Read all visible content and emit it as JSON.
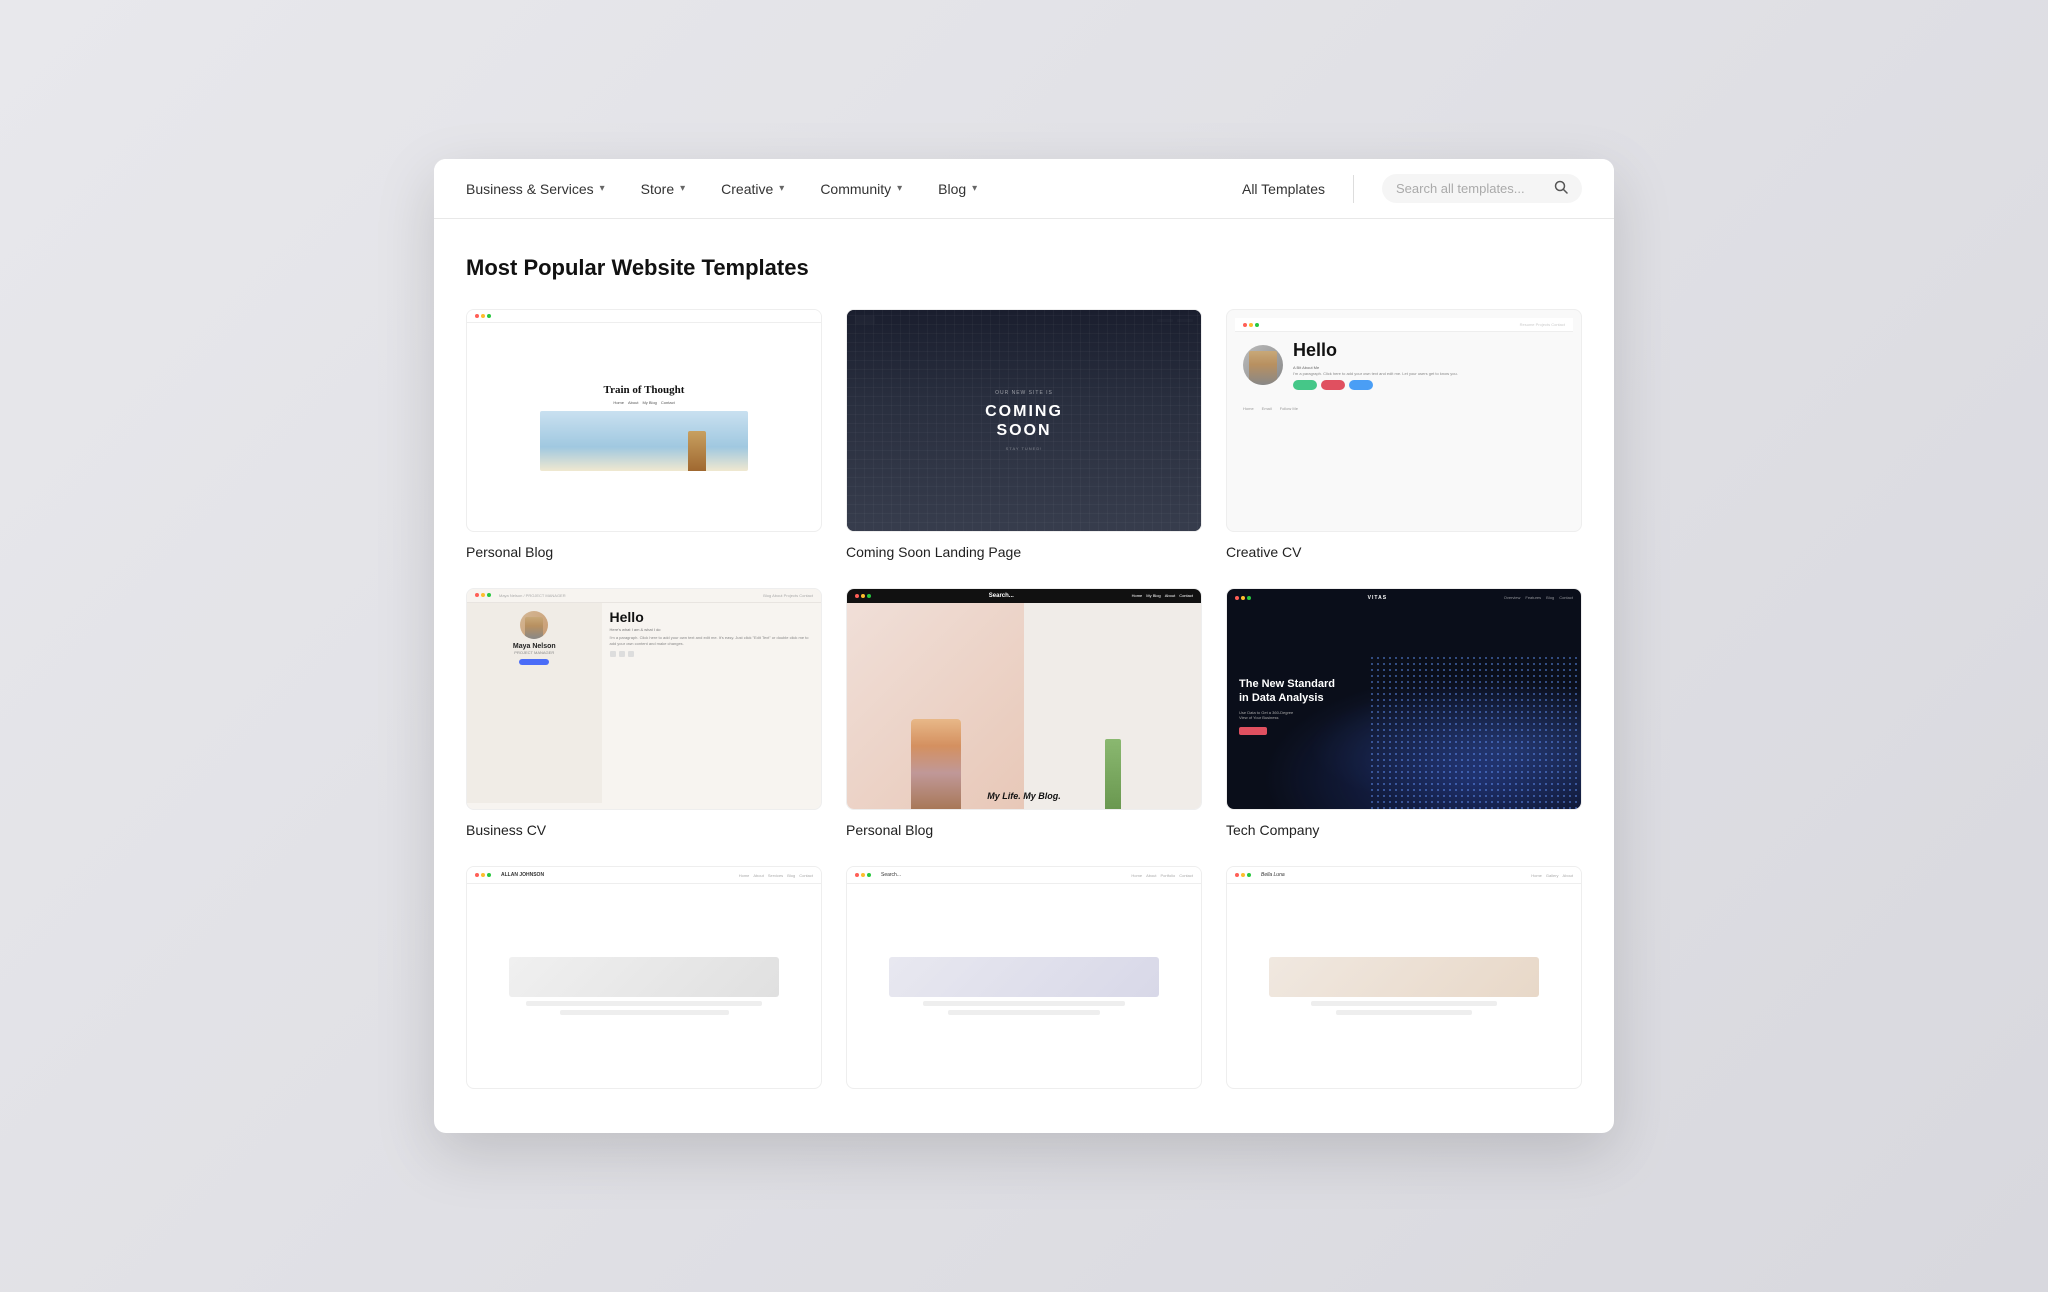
{
  "nav": {
    "items": [
      {
        "label": "Business & Services",
        "id": "business-services"
      },
      {
        "label": "Store",
        "id": "store"
      },
      {
        "label": "Creative",
        "id": "creative"
      },
      {
        "label": "Community",
        "id": "community"
      },
      {
        "label": "Blog",
        "id": "blog"
      }
    ],
    "all_templates_label": "All Templates",
    "search_placeholder": "Search all templates..."
  },
  "main": {
    "section_title": "Most Popular Website Templates",
    "templates": [
      {
        "id": "personal-blog-1",
        "name": "Personal Blog",
        "thumb_type": "personal-blog-1"
      },
      {
        "id": "coming-soon",
        "name": "Coming Soon Landing Page",
        "thumb_type": "coming-soon"
      },
      {
        "id": "creative-cv",
        "name": "Creative CV",
        "thumb_type": "creative-cv"
      },
      {
        "id": "business-cv",
        "name": "Business CV",
        "thumb_type": "business-cv"
      },
      {
        "id": "personal-blog-2",
        "name": "Personal Blog",
        "thumb_type": "personal-blog-2"
      },
      {
        "id": "tech-company",
        "name": "Tech Company",
        "thumb_type": "tech-company"
      },
      {
        "id": "placeholder-1",
        "name": "",
        "thumb_type": "placeholder"
      },
      {
        "id": "placeholder-2",
        "name": "",
        "thumb_type": "placeholder"
      },
      {
        "id": "placeholder-3",
        "name": "",
        "thumb_type": "placeholder"
      }
    ]
  },
  "icons": {
    "chevron": "▾",
    "search": "🔍"
  }
}
